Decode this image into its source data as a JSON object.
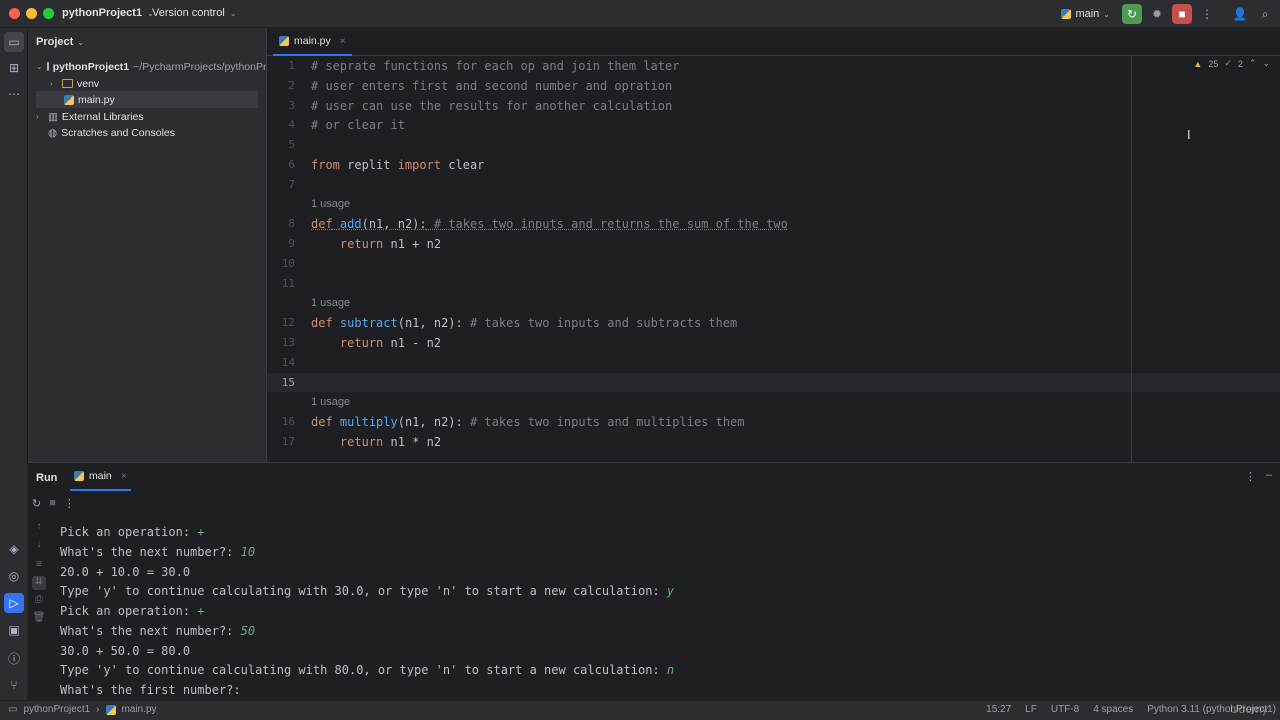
{
  "titlebar": {
    "project": "pythonProject1",
    "version_control": "Version control",
    "branch": "main"
  },
  "project_panel": {
    "title": "Project",
    "tree": [
      {
        "label": "pythonProject1",
        "extra": "~/PycharmProjects/pythonProje"
      },
      {
        "label": "venv"
      },
      {
        "label": "main.py"
      },
      {
        "label": "External Libraries"
      },
      {
        "label": "Scratches and Consoles"
      }
    ]
  },
  "editor": {
    "tab_label": "main.py",
    "inspections": {
      "warnings": "25",
      "ok": "2"
    },
    "line_numbers": [
      "1",
      "2",
      "3",
      "4",
      "5",
      "6",
      "7",
      "8",
      "9",
      "10",
      "11",
      "12",
      "13",
      "14",
      "15",
      "16",
      "17"
    ],
    "usage_hint": "1 usage",
    "lines": {
      "l1": "# seprate functions for each op and join them later",
      "l2": "# user enters first and second number and opration",
      "l3": "# user can use the results for another calculation",
      "l4": "# or clear it",
      "l6_kw1": "from",
      "l6_mod": " replit ",
      "l6_kw2": "import",
      "l6_name": " clear",
      "l8_kw": "def",
      "l8_fn": "add",
      "l8_sig": "(n1, n2):",
      "l8_cm": " # takes two inputs and returns the sum of the two",
      "l9_kw": "return",
      "l9_rest": " n1 + n2",
      "l12_kw": "def",
      "l12_fn": "subtract",
      "l12_sig": "(n1, n2):",
      "l12_cm": " # takes two inputs and subtracts them",
      "l13_kw": "return",
      "l13_rest": " n1 - n2",
      "l16_kw": "def",
      "l16_fn": "multiply",
      "l16_sig": "(n1, n2):",
      "l16_cm": " # takes two inputs and multiplies them",
      "l17_kw": "return",
      "l17_rest": " n1 * n2"
    }
  },
  "run_panel": {
    "title": "Run",
    "tab_label": "main",
    "output": [
      {
        "text": "Pick an operation: ",
        "input": "+"
      },
      {
        "text": "What's the next number?: ",
        "input": "10"
      },
      {
        "text": "20.0 + 10.0 = 30.0",
        "input": ""
      },
      {
        "text": "Type 'y' to continue calculating with 30.0, or type 'n' to start a new calculation: ",
        "input": "y"
      },
      {
        "text": "Pick an operation: ",
        "input": "+"
      },
      {
        "text": "What's the next number?: ",
        "input": "50"
      },
      {
        "text": "30.0 + 50.0 = 80.0",
        "input": ""
      },
      {
        "text": "Type 'y' to continue calculating with 80.0, or type 'n' to start a new calculation: ",
        "input": "n"
      },
      {
        "text": "What's the first number?:",
        "input": ""
      }
    ]
  },
  "statusbar": {
    "breadcrumb_project": "pythonProject1",
    "breadcrumb_file": "main.py",
    "position": "15:27",
    "line_ending": "LF",
    "encoding": "UTF-8",
    "indent": "4 spaces",
    "interpreter": "Python 3.11 (pythonProject1)",
    "watermark": "Udemy"
  },
  "colors": {
    "keyword": "#cf8e6d",
    "function": "#56a8f5",
    "comment": "#7a7e85",
    "accent": "#3574f0",
    "input": "#6aab73"
  }
}
